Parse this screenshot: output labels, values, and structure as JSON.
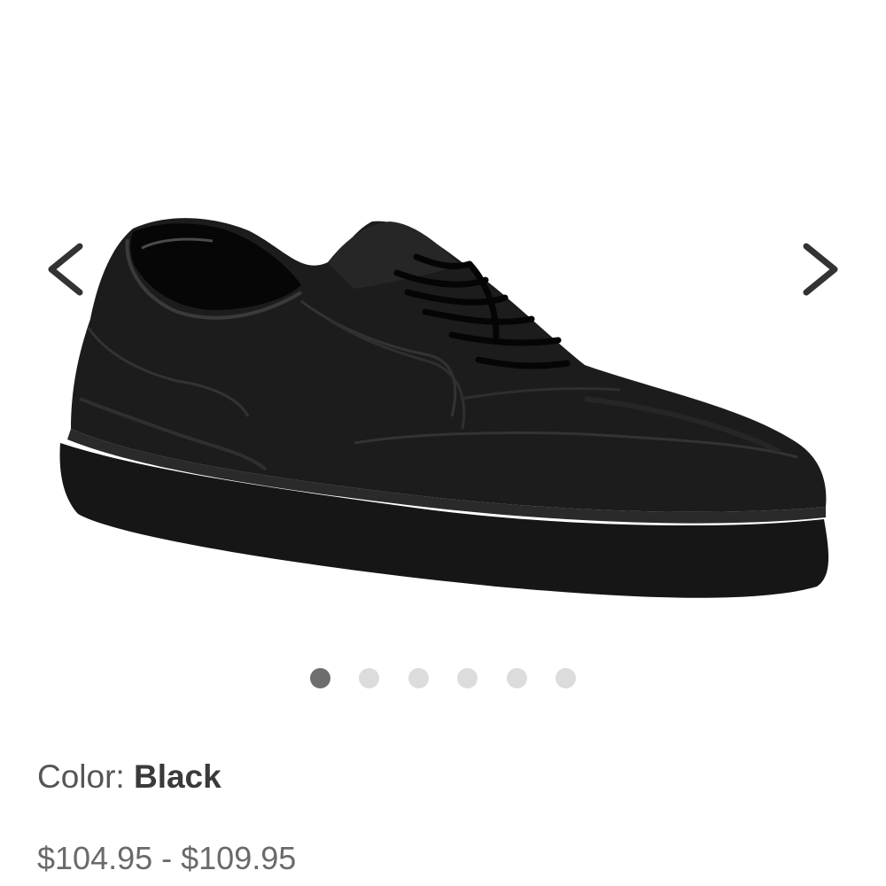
{
  "carousel": {
    "prev_icon": "chevron-left-icon",
    "next_icon": "chevron-right-icon",
    "image_subject": "black leather lace-up walking shoe",
    "slide_count": 6,
    "active_slide": 1
  },
  "product": {
    "color_label": "Color:",
    "color_value": "Black",
    "price_range": "$104.95 - $109.95"
  },
  "colors": {
    "text_primary": "#3a3a3a",
    "text_secondary": "#555555",
    "dot_active": "#6e6e6e",
    "dot_inactive": "#dcdcdc"
  }
}
